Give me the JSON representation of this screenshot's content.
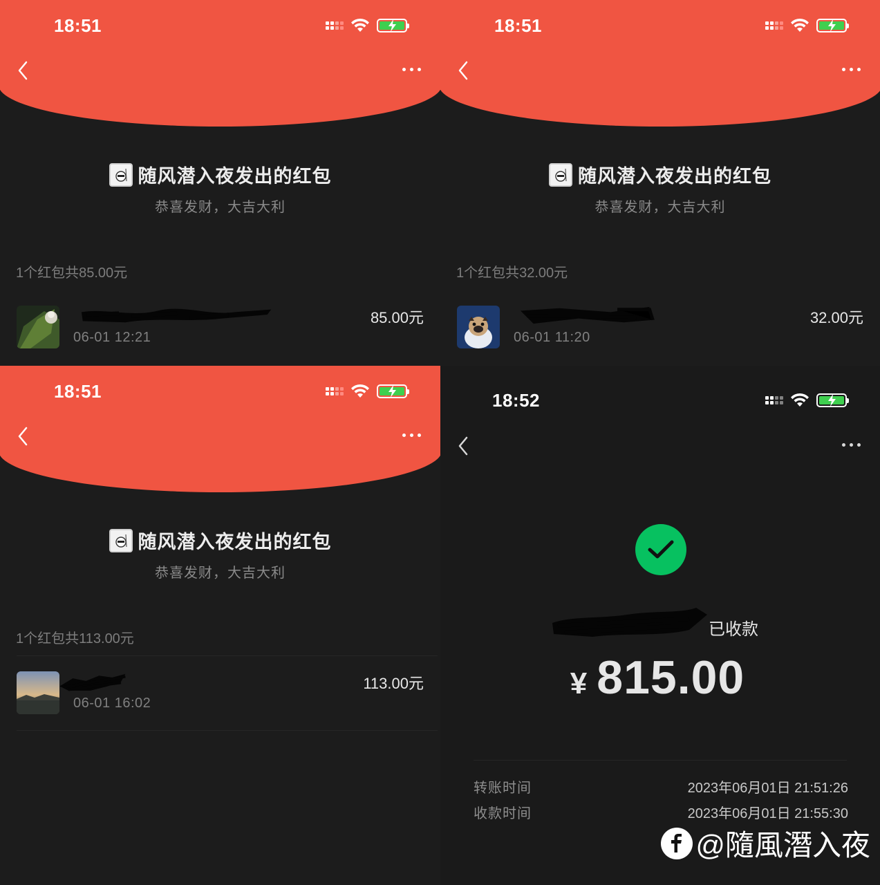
{
  "colors": {
    "header_red": "#f05542",
    "check_green": "#07c160",
    "background": "#1c1c1c"
  },
  "panels": [
    {
      "status_time": "18:51",
      "sender_title": "随风潜入夜发出的红包",
      "wish": "恭喜发财，大吉大利",
      "summary": "1个红包共85.00元",
      "record": {
        "time": "06-01 12:21",
        "amount": "85.00元",
        "avatar_icon": "leaf-photo-avatar"
      }
    },
    {
      "status_time": "18:51",
      "sender_title": "随风潜入夜发出的红包",
      "wish": "恭喜发财，大吉大利",
      "summary": "1个红包共32.00元",
      "record": {
        "time": "06-01 11:20",
        "amount": "32.00元",
        "avatar_icon": "pug-avatar"
      }
    },
    {
      "status_time": "18:51",
      "sender_title": "随风潜入夜发出的红包",
      "wish": "恭喜发财，大吉大利",
      "summary": "1个红包共113.00元",
      "record": {
        "time": "06-01 16:02",
        "amount": "113.00元",
        "avatar_icon": "sunset-photo-avatar"
      }
    }
  ],
  "transfer": {
    "status_time": "18:52",
    "received_label": "已收款",
    "currency": "¥",
    "amount": "815.00",
    "rows": [
      {
        "label": "转账时间",
        "value": "2023年06月01日 21:51:26"
      },
      {
        "label": "收款时间",
        "value": "2023年06月01日 21:55:30"
      }
    ]
  },
  "watermark": {
    "text": "@隨風潛入夜"
  }
}
